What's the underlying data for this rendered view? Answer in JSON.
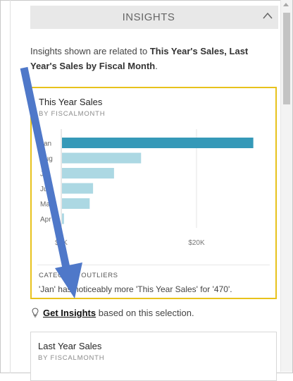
{
  "panel": {
    "header_title": "INSIGHTS",
    "description_prefix": "Insights shown are related to ",
    "description_bold": "This Year's Sales, Last Year's Sales by Fiscal Month",
    "description_suffix": "."
  },
  "card1": {
    "title": "This Year Sales",
    "subtitle": "BY FISCALMONTH",
    "outlier_label": "CATEGORY OUTLIERS",
    "outlier_text": "'Jan' has noticeably more 'This Year Sales' for '470'."
  },
  "chart_data": {
    "type": "bar",
    "orientation": "horizontal",
    "categories": [
      "Jan",
      "Aug",
      "Jul",
      "Jun",
      "Mar",
      "Apr"
    ],
    "values": [
      28400,
      11800,
      7800,
      4700,
      4200,
      400
    ],
    "xlim": [
      0,
      30000
    ],
    "xticks": [
      "$0K",
      "$20K"
    ],
    "highlight_category": "Jan",
    "colors": {
      "highlight": "#3599b8",
      "normal": "#acd8e3"
    }
  },
  "insights_link": {
    "label": "Get Insights",
    "suffix": " based on this selection."
  },
  "card2": {
    "title": "Last Year Sales",
    "subtitle": "BY FISCALMONTH"
  },
  "colors": {
    "selected_card_border": "#e8c21c",
    "annotation_arrow": "#4f78c9"
  }
}
